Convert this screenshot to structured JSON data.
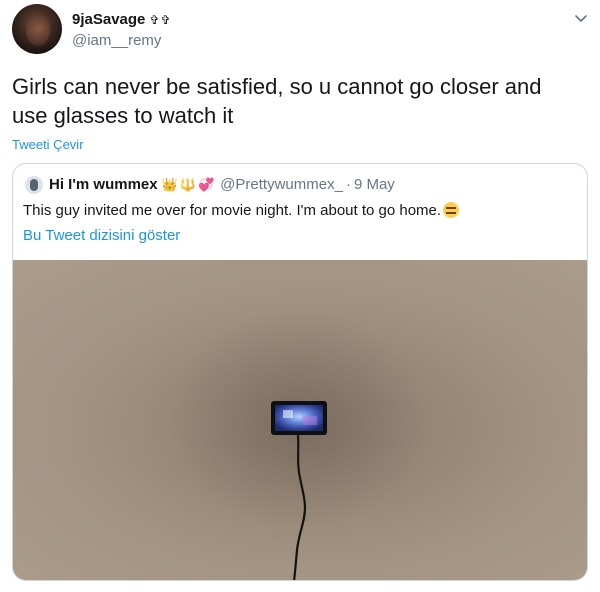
{
  "tweet": {
    "display_name": "9jaSavage",
    "badges": "✞✞",
    "handle": "@iam__remy",
    "text": "Girls can never be satisfied, so u cannot go closer and use glasses to watch it",
    "translate_label": "Tweeti Çevir"
  },
  "quoted": {
    "display_name": "Hi I'm wummex",
    "emojis": "👑🔱💞",
    "handle": "@Prettywummex_",
    "separator": "·",
    "date": "9 May",
    "text": "This guy invited me over for movie night. I'm about to go home.",
    "thread_link": "Bu Tweet dizisini göster"
  },
  "icons": {
    "more": "chevron-down-icon",
    "emoji": "expressionless-face-icon"
  },
  "colors": {
    "link": "#1b95e0",
    "secondary_text": "#657786",
    "border": "#ccd6dd"
  }
}
